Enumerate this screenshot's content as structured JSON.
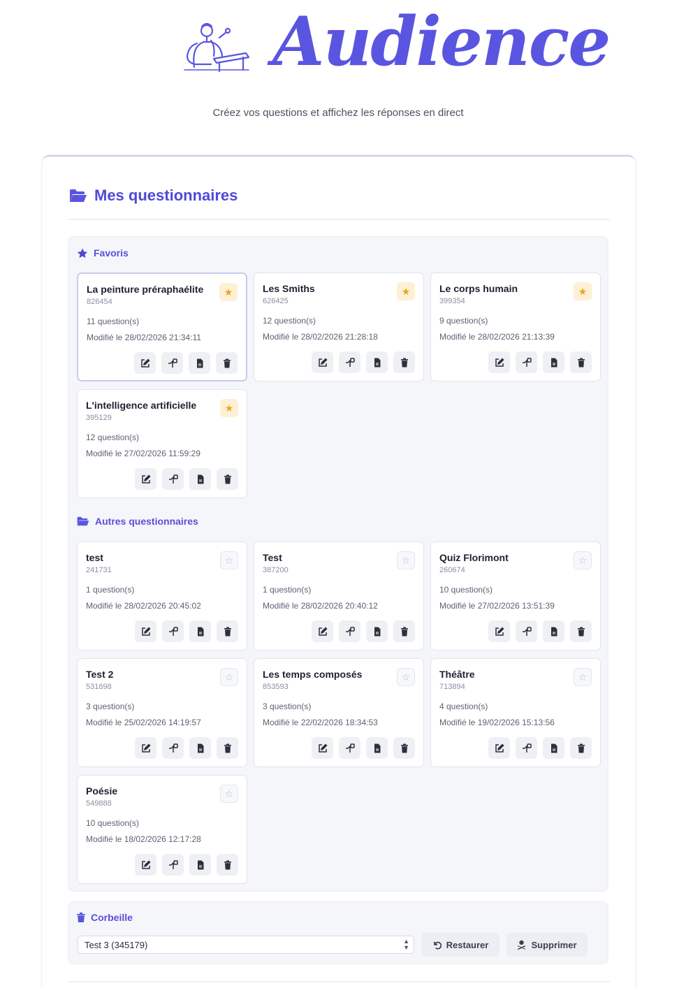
{
  "app": {
    "brand": "Audience",
    "subtitle": "Créez vos questions et affichez les réponses en direct"
  },
  "main": {
    "title": "Mes questionnaires"
  },
  "sections": {
    "favorites_label": "Favoris",
    "others_label": "Autres questionnaires"
  },
  "favorites": [
    {
      "title": "La peinture préraphaélite",
      "code": "826454",
      "questions": "11 question(s)",
      "modified": "Modifié le 28/02/2026 21:34:11",
      "favorite": true
    },
    {
      "title": "Les Smiths",
      "code": "626425",
      "questions": "12 question(s)",
      "modified": "Modifié le 28/02/2026 21:28:18",
      "favorite": true
    },
    {
      "title": "Le corps humain",
      "code": "399354",
      "questions": "9 question(s)",
      "modified": "Modifié le 28/02/2026 21:13:39",
      "favorite": true
    },
    {
      "title": "L'intelligence artificielle",
      "code": "395129",
      "questions": "12 question(s)",
      "modified": "Modifié le 27/02/2026 11:59:29",
      "favorite": true
    }
  ],
  "others": [
    {
      "title": "test",
      "code": "241731",
      "questions": "1 question(s)",
      "modified": "Modifié le 28/02/2026 20:45:02",
      "favorite": false
    },
    {
      "title": "Test",
      "code": "387200",
      "questions": "1 question(s)",
      "modified": "Modifié le 28/02/2026 20:40:12",
      "favorite": false
    },
    {
      "title": "Quiz Florimont",
      "code": "260674",
      "questions": "10 question(s)",
      "modified": "Modifié le 27/02/2026 13:51:39",
      "favorite": false
    },
    {
      "title": "Test 2",
      "code": "531698",
      "questions": "3 question(s)",
      "modified": "Modifié le 25/02/2026 14:19:57",
      "favorite": false
    },
    {
      "title": "Les temps composés",
      "code": "853593",
      "questions": "3 question(s)",
      "modified": "Modifié le 22/02/2026 18:34:53",
      "favorite": false
    },
    {
      "title": "Théâtre",
      "code": "713894",
      "questions": "4 question(s)",
      "modified": "Modifié le 19/02/2026 15:13:56",
      "favorite": false
    },
    {
      "title": "Poésie",
      "code": "549888",
      "questions": "10 question(s)",
      "modified": "Modifié le 18/02/2026 12:17:28",
      "favorite": false
    }
  ],
  "trash": {
    "label": "Corbeille",
    "selected": "Test 3 (345179)",
    "restore_label": "Restaurer",
    "delete_label": "Supprimer"
  },
  "colors": {
    "accent": "#5a55e0",
    "star_on": "#f0a21a",
    "panel_bg": "#f5f6fa"
  }
}
